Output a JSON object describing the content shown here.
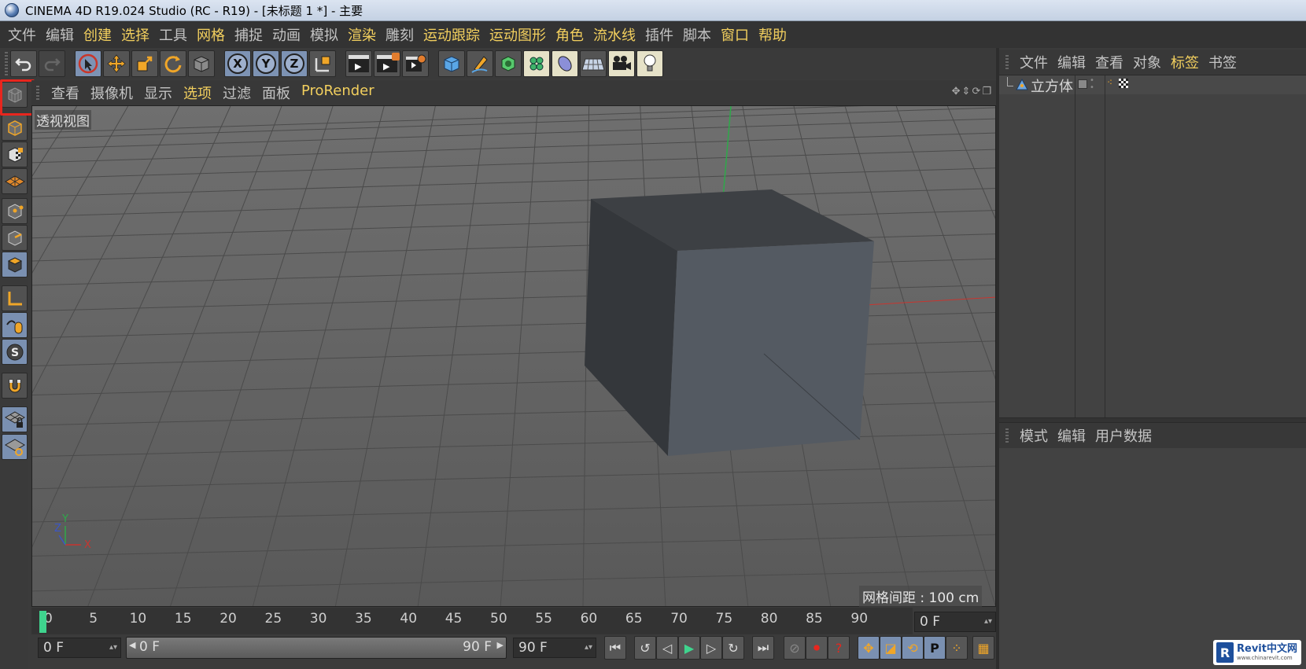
{
  "window": {
    "title": "CINEMA 4D R19.024 Studio (RC - R19) - [未标题 1 *] - 主要"
  },
  "menu": [
    {
      "label": "文件",
      "hl": false
    },
    {
      "label": "编辑",
      "hl": false
    },
    {
      "label": "创建",
      "hl": true
    },
    {
      "label": "选择",
      "hl": true
    },
    {
      "label": "工具",
      "hl": false
    },
    {
      "label": "网格",
      "hl": true
    },
    {
      "label": "捕捉",
      "hl": false
    },
    {
      "label": "动画",
      "hl": false
    },
    {
      "label": "模拟",
      "hl": false
    },
    {
      "label": "渲染",
      "hl": true
    },
    {
      "label": "雕刻",
      "hl": false
    },
    {
      "label": "运动跟踪",
      "hl": true
    },
    {
      "label": "运动图形",
      "hl": true
    },
    {
      "label": "角色",
      "hl": true
    },
    {
      "label": "流水线",
      "hl": true
    },
    {
      "label": "插件",
      "hl": false
    },
    {
      "label": "脚本",
      "hl": false
    },
    {
      "label": "窗口",
      "hl": true
    },
    {
      "label": "帮助",
      "hl": true
    }
  ],
  "toolbar": {
    "axis_x": "X",
    "axis_y": "Y",
    "axis_z": "Z",
    "icons": [
      "undo-icon",
      "redo-icon",
      "live-select-icon",
      "move-icon",
      "scale-icon",
      "rotate-icon",
      "recent-object-icon",
      "x-axis-icon",
      "y-axis-icon",
      "z-axis-icon",
      "coordinate-system-icon",
      "render-view-icon",
      "render-to-picture-viewer-icon",
      "render-settings-icon",
      "cube-icon",
      "pen-icon",
      "subdivision-icon",
      "cloner-icon",
      "deformer-icon",
      "floor-icon",
      "camera-icon",
      "light-icon"
    ]
  },
  "viewport": {
    "menu": [
      {
        "label": "查看",
        "hl": false
      },
      {
        "label": "摄像机",
        "hl": false
      },
      {
        "label": "显示",
        "hl": false
      },
      {
        "label": "选项",
        "hl": true
      },
      {
        "label": "过滤",
        "hl": false
      },
      {
        "label": "面板",
        "hl": false
      },
      {
        "label": "ProRender",
        "hl": true
      }
    ],
    "label": "透视视图",
    "grid_spacing": "网格间距 : 100 cm",
    "axis_y": "Y",
    "axis_z": "Z",
    "axis_x": "X"
  },
  "timeline": {
    "ticks": [
      "0",
      "5",
      "10",
      "15",
      "20",
      "25",
      "30",
      "35",
      "40",
      "45",
      "50",
      "55",
      "60",
      "65",
      "70",
      "75",
      "80",
      "85",
      "90"
    ],
    "current_frame": "0 F",
    "start_frame": "0 F",
    "range_start": "0 F",
    "range_end": "90 F",
    "end_frame": "90 F"
  },
  "object_manager": {
    "menu": [
      {
        "label": "文件",
        "hl": false
      },
      {
        "label": "编辑",
        "hl": false
      },
      {
        "label": "查看",
        "hl": false
      },
      {
        "label": "对象",
        "hl": false
      },
      {
        "label": "标签",
        "hl": true
      },
      {
        "label": "书签",
        "hl": false
      }
    ],
    "objects": [
      {
        "name": "立方体"
      }
    ]
  },
  "attribute_manager": {
    "menu": [
      {
        "label": "模式"
      },
      {
        "label": "编辑"
      },
      {
        "label": "用户数据"
      }
    ]
  },
  "watermark": {
    "main": "Revit中文网",
    "sub": "www.chinarevit.com",
    "logo": "R"
  },
  "colors": {
    "accent_yellow": "#f2cf5e",
    "tool_blue": "#7a90b1",
    "highlight_red": "#e8261e",
    "play_green": "#3fd48e"
  }
}
